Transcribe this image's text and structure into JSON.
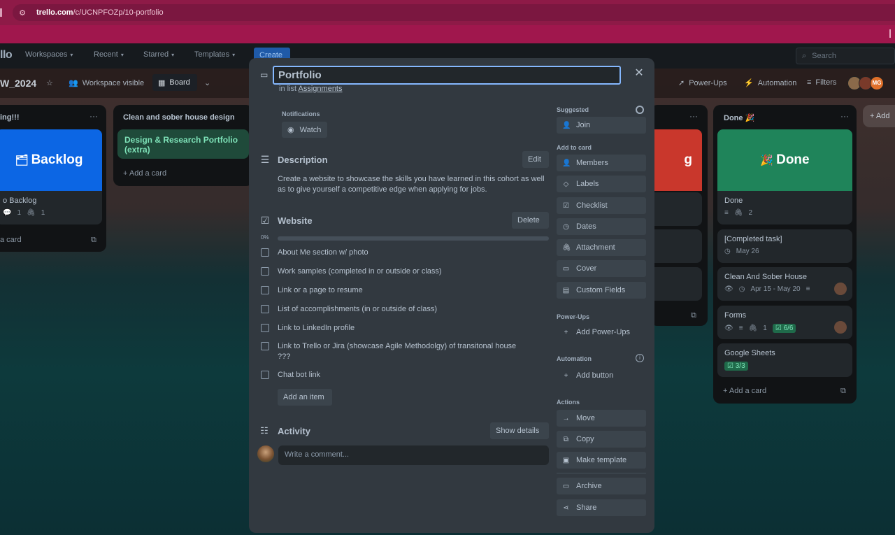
{
  "browser": {
    "url_host": "trello.com",
    "url_path": "/c/UCNPFOZp/10-portfolio"
  },
  "topnav": {
    "logo": "llo",
    "items": [
      "Workspaces",
      "Recent",
      "Starred",
      "Templates"
    ],
    "create_label": "Create",
    "search_placeholder": "Search"
  },
  "boardbar": {
    "board_name": "W_2024",
    "visibility": "Workspace visible",
    "view": "Board",
    "power_ups": "Power-Ups",
    "automation": "Automation",
    "filters": "Filters",
    "avatar_initials": "MG"
  },
  "lists": [
    {
      "title": "ing!!!",
      "cover_text": "Backlog",
      "cover_color": "#0c66e4",
      "card_title": "o Backlog",
      "card_meta": [
        "1",
        "1"
      ],
      "add_card": "a card"
    },
    {
      "title": "Clean and sober house design",
      "card_title": "Design & Research Portfolio (extra)",
      "add_card": "Add a card"
    },
    {
      "title": "Done 🎉",
      "cover_text": "Done",
      "cover_color": "#1f845a",
      "cards": [
        {
          "title": "Done",
          "meta": "2"
        },
        {
          "title": "[Completed task]",
          "meta": "May 26"
        },
        {
          "title": "Clean And Sober House",
          "meta": "Apr 15 - May 20"
        },
        {
          "title": "Forms",
          "meta": "1",
          "badge": "6/6"
        },
        {
          "title": "Google Sheets",
          "badge": "3/3"
        }
      ],
      "add_card": "Add a card",
      "add_list": "Add"
    }
  ],
  "modal": {
    "title": "Portfolio",
    "in_list_prefix": "in list",
    "in_list_name": "Assignments",
    "notifications_label": "Notifications",
    "watch_label": "Watch",
    "description": {
      "heading": "Description",
      "edit_label": "Edit",
      "text": "Create a website to showcase the skills you have learned in this cohort as well as to give yourself a competitive edge when applying for jobs."
    },
    "checklist": {
      "heading": "Website",
      "delete_label": "Delete",
      "progress_text": "0%",
      "progress": 0,
      "items": [
        "About Me section w/ photo",
        "Work samples (completed in or outside or class)",
        "Link or a page to resume",
        "List of accomplishments (in or outside of class)",
        "Link to LinkedIn profile",
        "Link to Trello or Jira (showcase Agile Methodolgy) of transitonal house ???",
        "Chat bot link"
      ],
      "add_item_label": "Add an item"
    },
    "activity": {
      "heading": "Activity",
      "show_details_label": "Show details",
      "comment_placeholder": "Write a comment..."
    },
    "sidebar": {
      "suggested_label": "Suggested",
      "join_label": "Join",
      "add_to_card_label": "Add to card",
      "add_to_card": [
        "Members",
        "Labels",
        "Checklist",
        "Dates",
        "Attachment",
        "Cover",
        "Custom Fields"
      ],
      "power_ups_label": "Power-Ups",
      "add_power_ups_label": "Add Power-Ups",
      "automation_label": "Automation",
      "add_button_label": "Add button",
      "actions_label": "Actions",
      "actions": [
        "Move",
        "Copy",
        "Make template"
      ],
      "archive_label": "Archive",
      "share_label": "Share"
    }
  }
}
